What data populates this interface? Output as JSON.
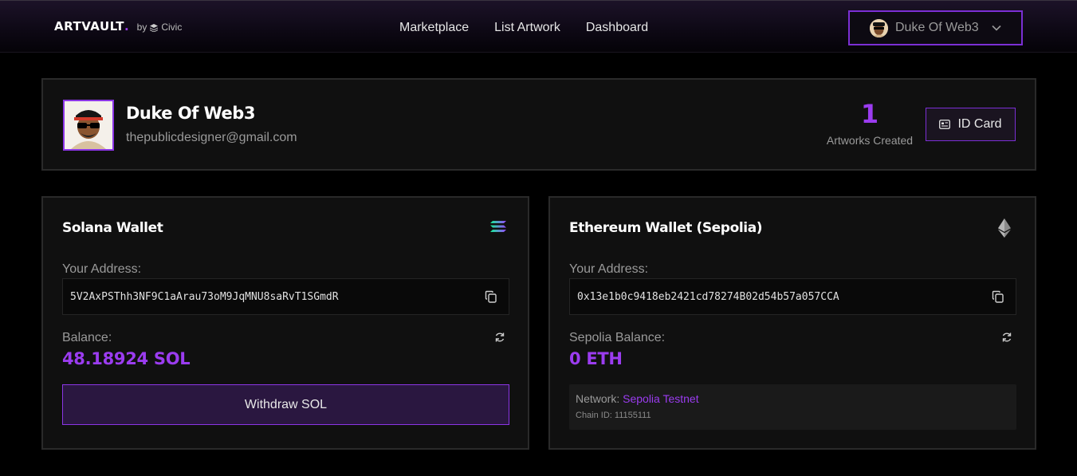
{
  "header": {
    "logo": "ARTVAULT",
    "logo_dot": ".",
    "by_label": "by",
    "partner": "Civic",
    "nav": [
      "Marketplace",
      "List Artwork",
      "Dashboard"
    ],
    "user_name": "Duke Of Web3"
  },
  "profile": {
    "name": "Duke Of Web3",
    "email": "thepublicdesigner@gmail.com",
    "artworks_count": "1",
    "artworks_label": "Artworks Created",
    "id_card_label": "ID Card"
  },
  "solana": {
    "title": "Solana Wallet",
    "address_label": "Your Address:",
    "address": "5V2AxPSThh3NF9C1aArau73oM9JqMNU8saRvT1SGmdR",
    "balance_label": "Balance:",
    "balance": "48.18924 SOL",
    "withdraw_label": "Withdraw SOL"
  },
  "ethereum": {
    "title": "Ethereum Wallet (Sepolia)",
    "address_label": "Your Address:",
    "address": "0x13e1b0c9418eb2421cd78274B02d54b57a057CCA",
    "balance_label": "Sepolia Balance:",
    "balance": "0 ETH",
    "network_label": "Network:",
    "network_value": "Sepolia Testnet",
    "chain_id": "Chain ID: 11155111"
  },
  "colors": {
    "accent": "#9b3cf0",
    "background": "#000000",
    "card": "#101010"
  },
  "icons": {
    "logo_partner": "civic-stack-icon",
    "user_menu": "chevron-down-icon",
    "id_card": "id-card-icon",
    "solana": "solana-logo-icon",
    "ethereum": "ethereum-logo-icon",
    "copy": "copy-icon",
    "refresh": "refresh-icon"
  }
}
